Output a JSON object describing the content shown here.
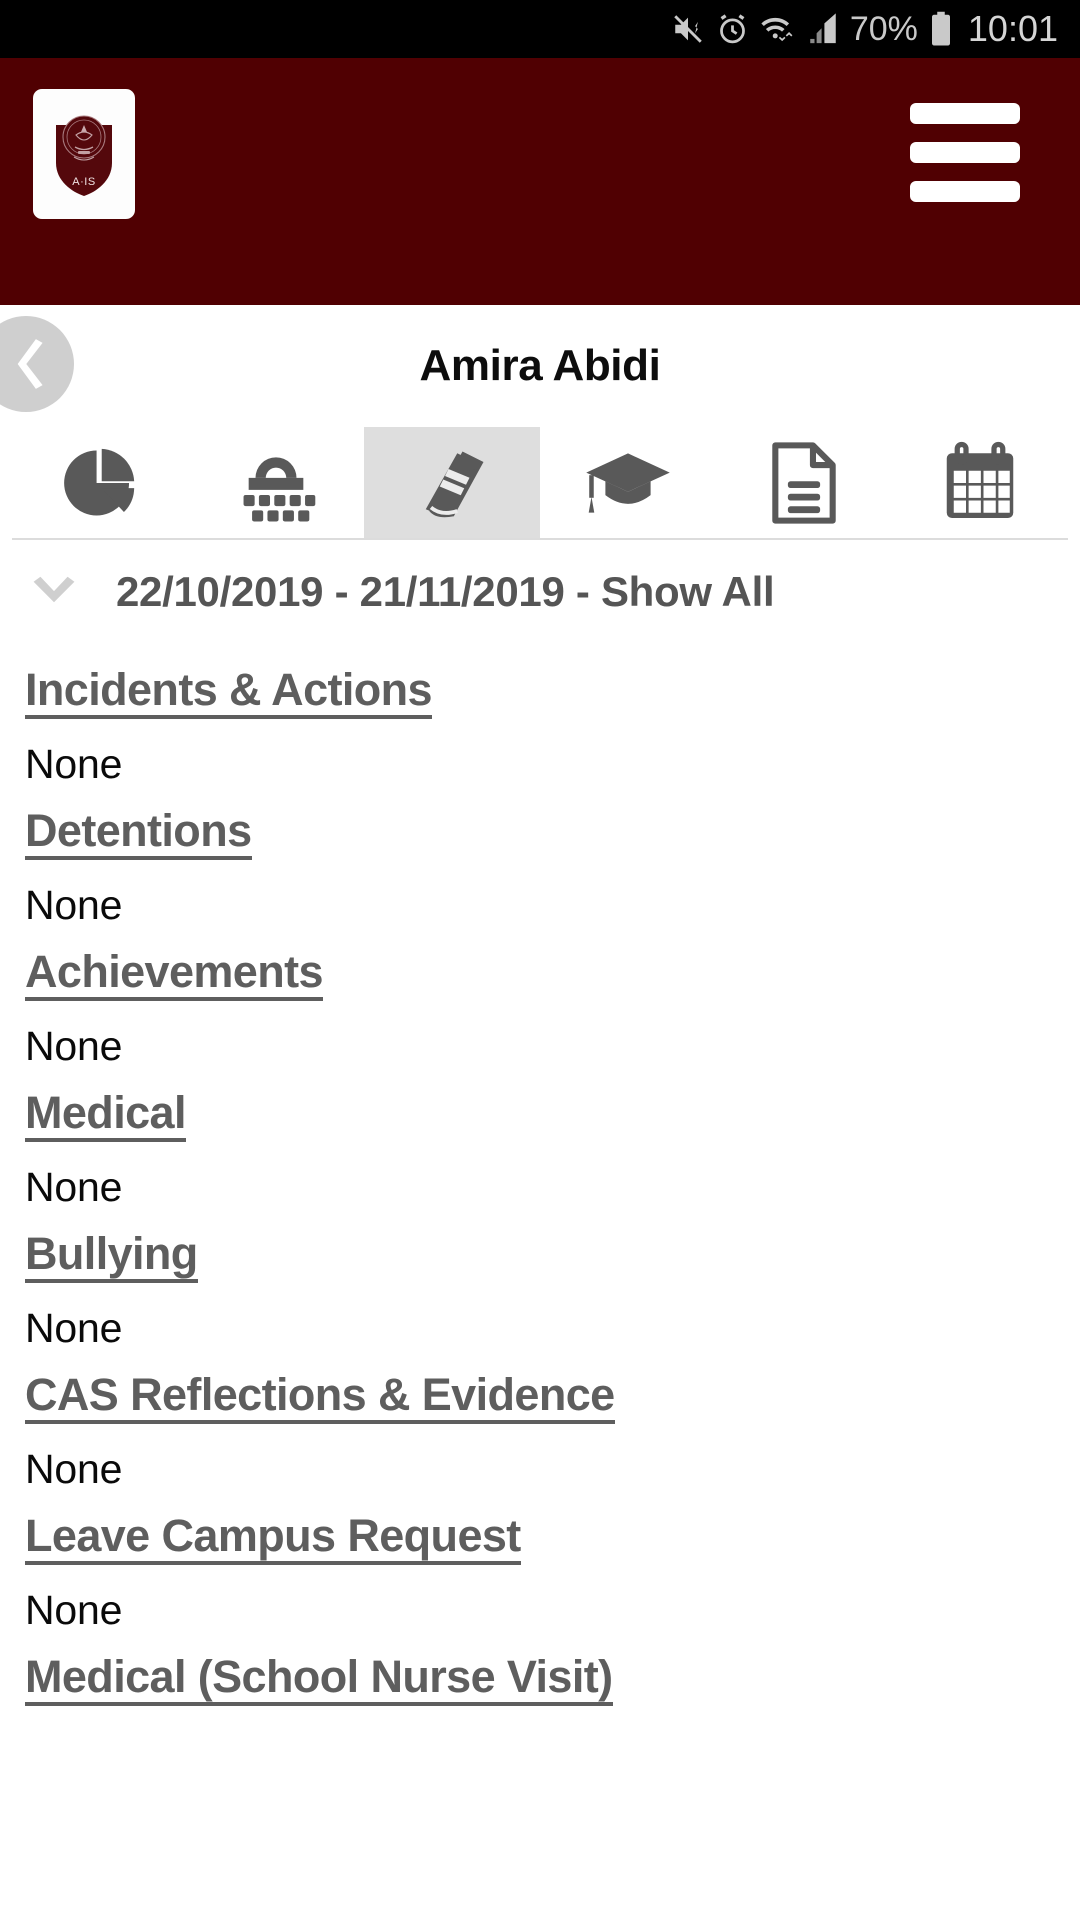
{
  "status_bar": {
    "icons": [
      "mute-vibrate-icon",
      "alarm-clock-icon",
      "wifi-icon",
      "signal-bars-icon"
    ],
    "battery_percent": "70%",
    "battery_icon": "battery-icon",
    "time": "10:01"
  },
  "app_header": {
    "logo_alt": "A-IS school crest logo",
    "logo_text": "A·IS",
    "menu_label": "hamburger-menu",
    "background_color": "#500002"
  },
  "title_bar": {
    "back_label": "Back",
    "student_name": "Amira Abidi"
  },
  "tabs": [
    {
      "id": "tab-summary",
      "icon": "pie-chart-icon",
      "active": false
    },
    {
      "id": "tab-attendance",
      "icon": "abacus-icon",
      "active": false
    },
    {
      "id": "tab-behaviour",
      "icon": "book-icon",
      "active": true
    },
    {
      "id": "tab-academic",
      "icon": "graduation-cap-icon",
      "active": false
    },
    {
      "id": "tab-reports",
      "icon": "document-icon",
      "active": false
    },
    {
      "id": "tab-timetable",
      "icon": "calendar-icon",
      "active": false
    }
  ],
  "date_filter": {
    "chevron": "chevron-down-icon",
    "label": "22/10/2019 - 21/11/2019 - Show All"
  },
  "sections": [
    {
      "header": "Incidents & Actions",
      "value": "None"
    },
    {
      "header": "Detentions",
      "value": "None"
    },
    {
      "header": "Achievements",
      "value": "None"
    },
    {
      "header": "Medical",
      "value": "None"
    },
    {
      "header": "Bullying",
      "value": "None"
    },
    {
      "header": "CAS Reflections & Evidence",
      "value": "None"
    },
    {
      "header": "Leave Campus Request",
      "value": "None"
    },
    {
      "header": "Medical (School Nurse Visit)",
      "value": ""
    }
  ]
}
